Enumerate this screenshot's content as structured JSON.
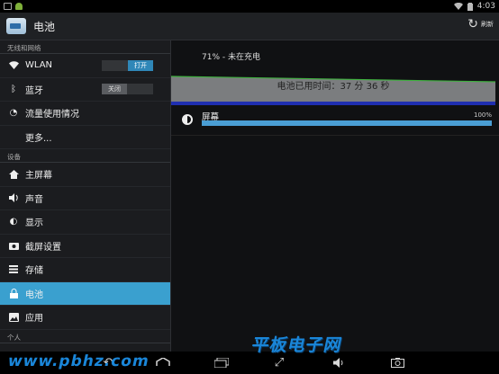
{
  "status_bar": {
    "time": "4:03",
    "icons": [
      "image-icon",
      "android-icon",
      "wifi-icon",
      "battery-icon"
    ]
  },
  "action_bar": {
    "title": "电池",
    "refresh_label": "刷新",
    "refresh_icon": "refresh-icon"
  },
  "sidebar": {
    "sections": [
      {
        "header": "无线和网络",
        "items": [
          {
            "label": "WLAN",
            "icon": "wifi-icon",
            "toggle": "打开",
            "toggle_state": "on"
          },
          {
            "label": "蓝牙",
            "icon": "bluetooth-icon",
            "toggle": "关闭",
            "toggle_state": "off"
          },
          {
            "label": "流量使用情况",
            "icon": "data-usage-icon"
          },
          {
            "label": "更多...",
            "icon": ""
          }
        ]
      },
      {
        "header": "设备",
        "items": [
          {
            "label": "主屏幕",
            "icon": "home-icon"
          },
          {
            "label": "声音",
            "icon": "volume-icon"
          },
          {
            "label": "显示",
            "icon": "display-icon"
          },
          {
            "label": "截屏设置",
            "icon": "screenshot-icon"
          },
          {
            "label": "存储",
            "icon": "storage-icon"
          },
          {
            "label": "电池",
            "icon": "battery-lock-icon",
            "active": true
          },
          {
            "label": "应用",
            "icon": "apps-icon"
          }
        ]
      },
      {
        "header": "个人",
        "items": []
      }
    ]
  },
  "main": {
    "battery_status": "71% - 未在充电",
    "graph_label": "电池已用时间：37 分 36 秒",
    "usage": [
      {
        "label": "屏幕",
        "percent_text": "100%",
        "fraction": 1.0,
        "icon": "brightness-icon"
      }
    ]
  },
  "colors": {
    "accent": "#3aa0cf",
    "graph_fill": "#7b7d7f",
    "graph_line": "#3fb13f",
    "graph_base": "#1f2fb0",
    "usage_bar": "#4a9ed4",
    "watermark": "#1a86d9"
  },
  "nav_bar": {
    "buttons": [
      "back-icon",
      "home-icon",
      "recents-icon",
      "fullscreen-icon",
      "volume-icon",
      "camera-icon"
    ]
  },
  "watermark": {
    "title": "平板电子网",
    "url": "www.pbhz.com"
  }
}
